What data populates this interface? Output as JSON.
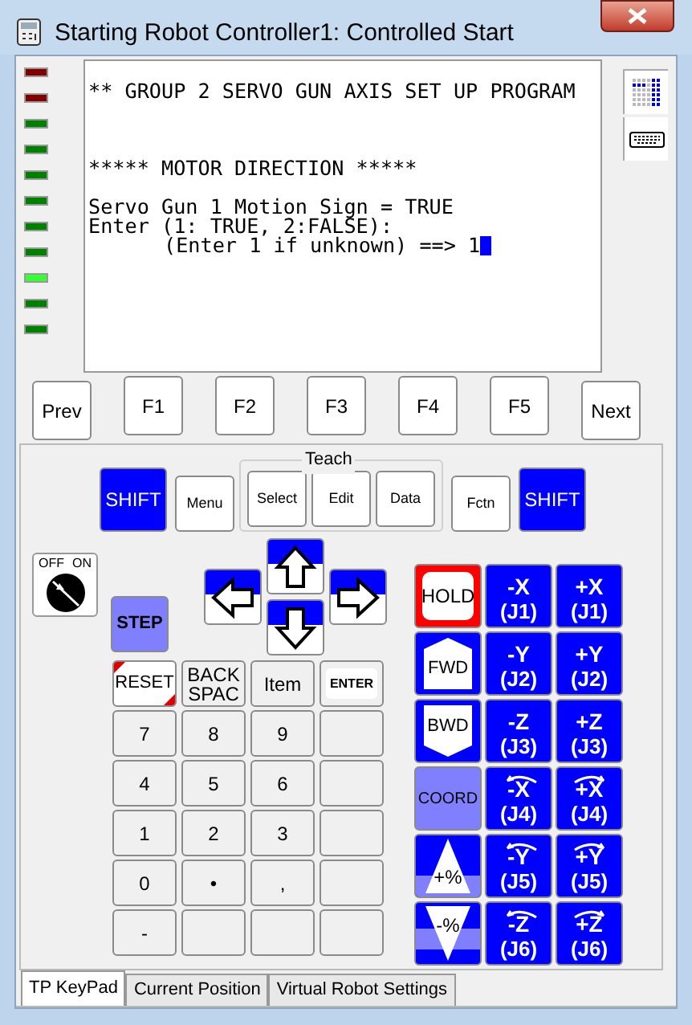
{
  "window": {
    "title": "Starting Robot Controller1: Controlled Start"
  },
  "leds": [
    {
      "color": "#800000"
    },
    {
      "color": "#800000"
    },
    {
      "color": "#008000"
    },
    {
      "color": "#008000"
    },
    {
      "color": "#008000"
    },
    {
      "color": "#008000"
    },
    {
      "color": "#008000"
    },
    {
      "color": "#008000"
    },
    {
      "color": "#33ff33"
    },
    {
      "color": "#008000"
    },
    {
      "color": "#008000"
    }
  ],
  "screen": {
    "blocks": [
      [
        {
          "text": "** GROUP 2 SERVO GUN AXIS SET UP PROGRAM",
          "indent": false
        }
      ],
      [
        {
          "text": "***** MOTOR DIRECTION *****",
          "indent": false
        }
      ],
      [
        {
          "text": "Servo Gun 1 Motion Sign = TRUE",
          "indent": false
        },
        {
          "text": "Enter (1: TRUE, 2:FALSE):",
          "indent": false
        },
        {
          "text": "(Enter 1 if unknown) ==> 1",
          "indent": true
        }
      ]
    ]
  },
  "function_keys": [
    {
      "label": "Prev",
      "kind": "nav"
    },
    {
      "label": "F1",
      "kind": "function"
    },
    {
      "label": "F2",
      "kind": "function"
    },
    {
      "label": "F3",
      "kind": "function"
    },
    {
      "label": "F4",
      "kind": "function"
    },
    {
      "label": "F5",
      "kind": "function"
    },
    {
      "label": "Next",
      "kind": "nav"
    }
  ],
  "top_row": {
    "left": [
      {
        "label": "SHIFT",
        "kind": "shift"
      },
      {
        "label": "Menu",
        "kind": "plain"
      }
    ],
    "teach": {
      "label": "Teach",
      "keys": [
        "Select",
        "Edit",
        "Data"
      ]
    },
    "right": [
      {
        "label": "Fctn",
        "kind": "plain"
      },
      {
        "label": "SHIFT",
        "kind": "shift"
      }
    ]
  },
  "key_switch": {
    "off_label": "OFF",
    "on_label": "ON",
    "on": false
  },
  "step_key": {
    "label": "STEP"
  },
  "number_pad": [
    [
      {
        "label": "RESET",
        "kind": "reset"
      },
      {
        "label": "BACK SPAC",
        "kind": "plain"
      },
      {
        "label": "Item",
        "kind": "plain"
      },
      {
        "label": "ENTER",
        "kind": "enter"
      }
    ],
    [
      {
        "label": "7",
        "kind": "plain"
      },
      {
        "label": "8",
        "kind": "plain"
      },
      {
        "label": "9",
        "kind": "plain"
      },
      {
        "kind": "blank"
      }
    ],
    [
      {
        "label": "4",
        "kind": "plain"
      },
      {
        "label": "5",
        "kind": "plain"
      },
      {
        "label": "6",
        "kind": "plain"
      },
      {
        "kind": "blank"
      }
    ],
    [
      {
        "label": "1",
        "kind": "plain"
      },
      {
        "label": "2",
        "kind": "plain"
      },
      {
        "label": "3",
        "kind": "plain"
      },
      {
        "kind": "blank"
      }
    ],
    [
      {
        "label": "0",
        "kind": "plain"
      },
      {
        "label": "•",
        "kind": "plain"
      },
      {
        "label": ",",
        "kind": "plain"
      },
      {
        "kind": "blank"
      }
    ],
    [
      {
        "label": "-",
        "kind": "plain"
      },
      {
        "kind": "blank"
      },
      {
        "kind": "blank"
      },
      {
        "kind": "blank"
      }
    ]
  ],
  "motion_keys": [
    [
      {
        "kind": "hold",
        "label": "HOLD"
      },
      {
        "kind": "jog",
        "axis": "-X",
        "joint": "(J1)",
        "rotation": false
      },
      {
        "kind": "jog",
        "axis": "+X",
        "joint": "(J1)",
        "rotation": false
      }
    ],
    [
      {
        "kind": "fwd",
        "label": "FWD"
      },
      {
        "kind": "jog",
        "axis": "-Y",
        "joint": "(J2)",
        "rotation": false
      },
      {
        "kind": "jog",
        "axis": "+Y",
        "joint": "(J2)",
        "rotation": false
      }
    ],
    [
      {
        "kind": "bwd",
        "label": "BWD"
      },
      {
        "kind": "jog",
        "axis": "-Z",
        "joint": "(J3)",
        "rotation": false
      },
      {
        "kind": "jog",
        "axis": "+Z",
        "joint": "(J3)",
        "rotation": false
      }
    ],
    [
      {
        "kind": "coord",
        "label": "COORD"
      },
      {
        "kind": "jog",
        "axis": "-X",
        "joint": "(J4)",
        "rotation": true
      },
      {
        "kind": "jog",
        "axis": "+X",
        "joint": "(J4)",
        "rotation": true
      }
    ],
    [
      {
        "kind": "speed_up",
        "label": "+%"
      },
      {
        "kind": "jog",
        "axis": "-Y",
        "joint": "(J5)",
        "rotation": true
      },
      {
        "kind": "jog",
        "axis": "+Y",
        "joint": "(J5)",
        "rotation": true
      }
    ],
    [
      {
        "kind": "speed_down",
        "label": "-%"
      },
      {
        "kind": "jog",
        "axis": "-Z",
        "joint": "(J6)",
        "rotation": true
      },
      {
        "kind": "jog",
        "axis": "+Z",
        "joint": "(J6)",
        "rotation": true
      }
    ]
  ],
  "tabs": [
    {
      "label": "TP KeyPad",
      "selected": true
    },
    {
      "label": "Current Position",
      "selected": false
    },
    {
      "label": "Virtual Robot Settings",
      "selected": false
    }
  ]
}
